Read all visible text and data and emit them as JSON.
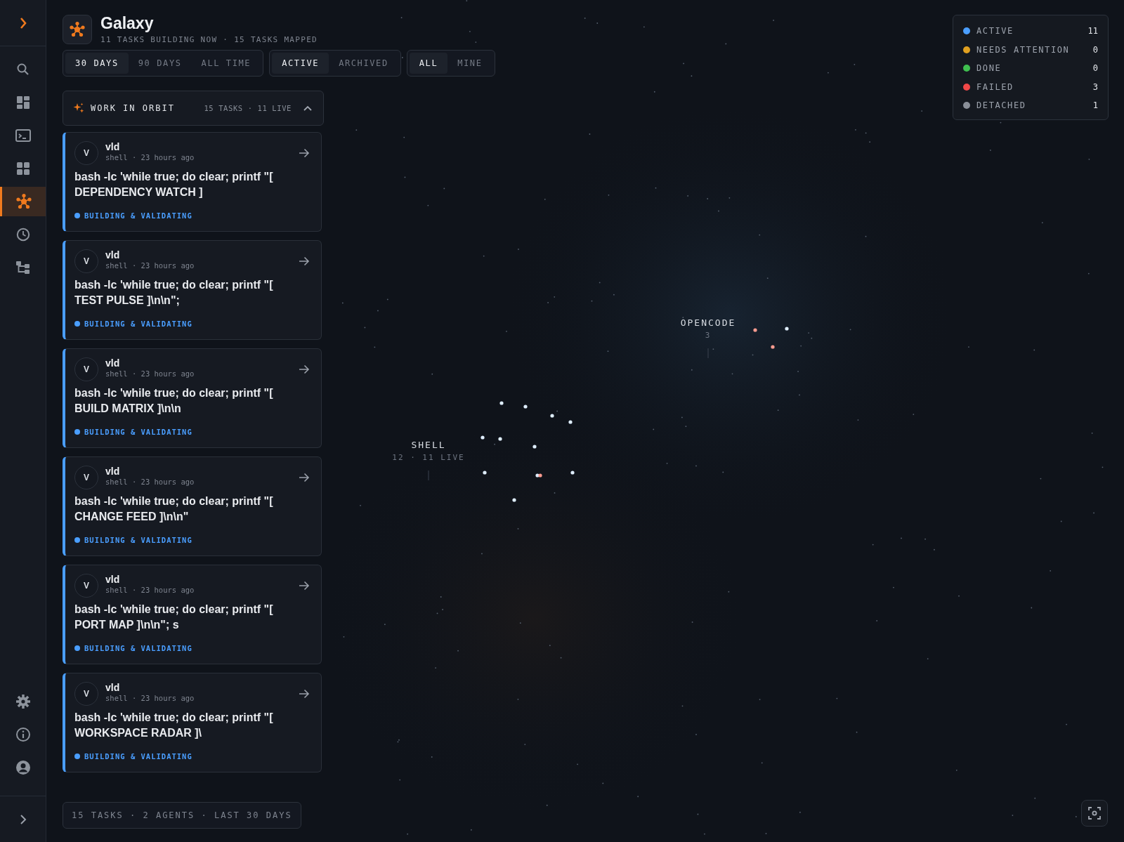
{
  "sidebar": {
    "items": [
      {
        "kind": "search",
        "selected": false
      },
      {
        "kind": "dashboard",
        "selected": false
      },
      {
        "kind": "terminal",
        "selected": false
      },
      {
        "kind": "grid",
        "selected": false
      },
      {
        "kind": "galaxy",
        "selected": true
      },
      {
        "kind": "history",
        "selected": false
      },
      {
        "kind": "tree",
        "selected": false
      }
    ],
    "bottom_items": [
      {
        "kind": "settings"
      },
      {
        "kind": "info"
      },
      {
        "kind": "account"
      }
    ]
  },
  "header": {
    "title": "Galaxy",
    "subtitle": "11 TASKS BUILDING NOW · 15 TASKS MAPPED"
  },
  "filters": [
    [
      {
        "label": "30 DAYS",
        "selected": true
      },
      {
        "label": "90 DAYS",
        "selected": false
      },
      {
        "label": "ALL TIME",
        "selected": false
      }
    ],
    [
      {
        "label": "ACTIVE",
        "selected": true
      },
      {
        "label": "ARCHIVED",
        "selected": false
      }
    ],
    [
      {
        "label": "ALL",
        "selected": true
      },
      {
        "label": "MINE",
        "selected": false
      }
    ]
  ],
  "orbit": {
    "title": "WORK IN ORBIT",
    "summary": "15 TASKS · 11 LIVE",
    "expanded": true
  },
  "tasks": [
    {
      "avatar": "V",
      "user": "vld",
      "meta": "shell · 23 hours ago",
      "command": "bash -lc 'while true; do clear; printf \"[ DEPENDENCY WATCH ]",
      "status": "BUILDING & VALIDATING",
      "color": "#4a9eff"
    },
    {
      "avatar": "V",
      "user": "vld",
      "meta": "shell · 23 hours ago",
      "command": "bash -lc 'while true; do clear; printf \"[ TEST PULSE ]\\n\\n\";",
      "status": "BUILDING & VALIDATING",
      "color": "#4a9eff"
    },
    {
      "avatar": "V",
      "user": "vld",
      "meta": "shell · 23 hours ago",
      "command": "bash -lc 'while true; do clear; printf \"[ BUILD MATRIX ]\\n\\n",
      "status": "BUILDING & VALIDATING",
      "color": "#4a9eff"
    },
    {
      "avatar": "V",
      "user": "vld",
      "meta": "shell · 23 hours ago",
      "command": "bash -lc 'while true; do clear; printf \"[ CHANGE FEED ]\\n\\n\"",
      "status": "BUILDING & VALIDATING",
      "color": "#4a9eff"
    },
    {
      "avatar": "V",
      "user": "vld",
      "meta": "shell · 23 hours ago",
      "command": "bash -lc 'while true; do clear; printf \"[ PORT MAP ]\\n\\n\"; s",
      "status": "BUILDING & VALIDATING",
      "color": "#4a9eff"
    },
    {
      "avatar": "V",
      "user": "vld",
      "meta": "shell · 23 hours ago",
      "command": "bash -lc 'while true; do clear; printf \"[ WORKSPACE RADAR ]\\",
      "status": "BUILDING & VALIDATING",
      "color": "#4a9eff"
    }
  ],
  "footer": "15 TASKS · 2 AGENTS · LAST 30 DAYS",
  "legend": [
    {
      "label": "ACTIVE",
      "count": "11",
      "color": "#4a9eff"
    },
    {
      "label": "NEEDS ATTENTION",
      "count": "0",
      "color": "#e0a020"
    },
    {
      "label": "DONE",
      "count": "0",
      "color": "#3fbf4f"
    },
    {
      "label": "FAILED",
      "count": "3",
      "color": "#f04848"
    },
    {
      "label": "DETACHED",
      "count": "1",
      "color": "#8a8f98"
    }
  ],
  "clusters": [
    {
      "name": "SHELL",
      "caption": "12 · 11 LIVE",
      "nodes": [
        {
          "color": "#dfeeff"
        },
        {
          "color": "#dfeeff"
        },
        {
          "color": "#dfeeff"
        },
        {
          "color": "#dfeeff"
        },
        {
          "color": "#dfeeff"
        },
        {
          "color": "#dfeeff"
        },
        {
          "color": "#dfeeff"
        },
        {
          "color": "#dfeeff"
        },
        {
          "color": "#dfeeff"
        },
        {
          "color": "#ff9c90"
        },
        {
          "color": "#dfeeff"
        },
        {
          "color": "#dfeeff"
        }
      ]
    },
    {
      "name": "OPENCODE",
      "caption": "3",
      "nodes": [
        {
          "color": "#ff9c90"
        },
        {
          "color": "#dfeeff"
        },
        {
          "color": "#ff9c90"
        }
      ]
    }
  ]
}
